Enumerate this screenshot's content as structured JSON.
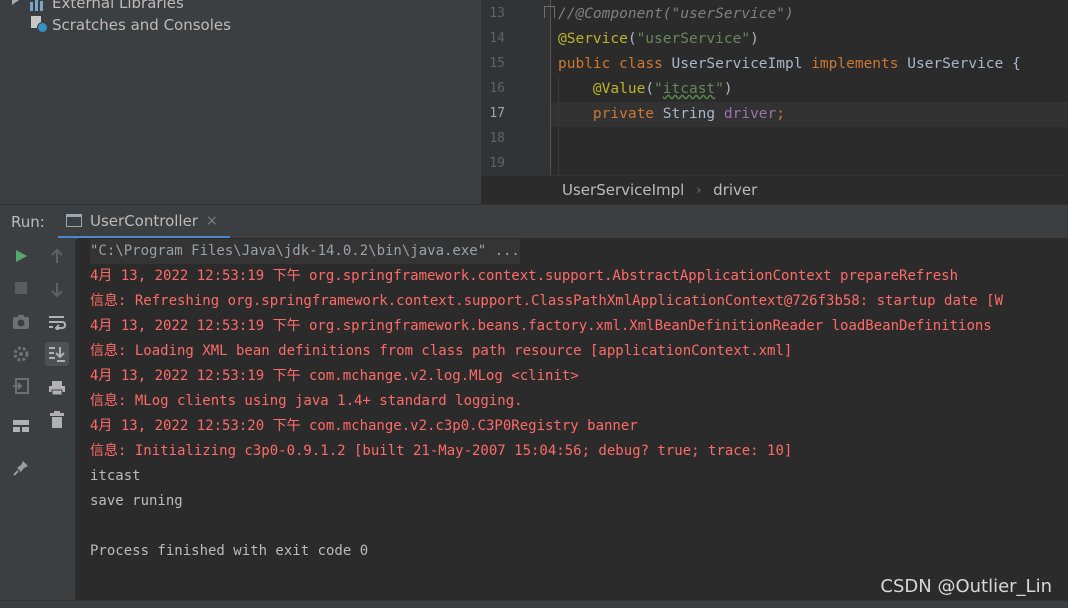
{
  "project_tree": {
    "items": [
      {
        "label": "External Libraries",
        "icon": "library-icon"
      },
      {
        "label": "Scratches and Consoles",
        "icon": "scratches-icon"
      }
    ]
  },
  "editor": {
    "lines": [
      {
        "num": "13",
        "text": "//@Component(\"userService\")"
      },
      {
        "num": "14",
        "text": "@Service(\"userService\")"
      },
      {
        "num": "15",
        "text": "public class UserServiceImpl implements UserService {"
      },
      {
        "num": "16",
        "text": "    @Value(\"itcast\")"
      },
      {
        "num": "17",
        "text": "    private String driver;"
      },
      {
        "num": "18",
        "text": ""
      },
      {
        "num": "19",
        "text": ""
      }
    ],
    "current_line": "17",
    "colors": {
      "keyword": "#cc7832",
      "annotation": "#bbb529",
      "string": "#6a8759",
      "comment": "#808080",
      "field": "#9876aa"
    }
  },
  "breadcrumb": {
    "items": [
      "UserServiceImpl",
      "driver"
    ]
  },
  "run_window": {
    "label": "Run:",
    "tab_label": "UserController",
    "tab_close": "×"
  },
  "console": {
    "lines": [
      {
        "text": "\"C:\\Program Files\\Java\\jdk-14.0.2\\bin\\java.exe\" ...",
        "style": "cmd"
      },
      {
        "text": "4月 13, 2022 12:53:19 下午 org.springframework.context.support.AbstractApplicationContext prepareRefresh",
        "style": "red"
      },
      {
        "text": "信息: Refreshing org.springframework.context.support.ClassPathXmlApplicationContext@726f3b58: startup date [W",
        "style": "red"
      },
      {
        "text": "4月 13, 2022 12:53:19 下午 org.springframework.beans.factory.xml.XmlBeanDefinitionReader loadBeanDefinitions",
        "style": "red"
      },
      {
        "text": "信息: Loading XML bean definitions from class path resource [applicationContext.xml]",
        "style": "red"
      },
      {
        "text": "4月 13, 2022 12:53:19 下午 com.mchange.v2.log.MLog <clinit>",
        "style": "red"
      },
      {
        "text": "信息: MLog clients using java 1.4+ standard logging.",
        "style": "red"
      },
      {
        "text": "4月 13, 2022 12:53:20 下午 com.mchange.v2.c3p0.C3P0Registry banner",
        "style": "red"
      },
      {
        "text": "信息: Initializing c3p0-0.9.1.2 [built 21-May-2007 15:04:56; debug? true; trace: 10]",
        "style": "red"
      },
      {
        "text": "itcast",
        "style": "normal"
      },
      {
        "text": "save runing",
        "style": "normal"
      },
      {
        "text": "",
        "style": "normal"
      },
      {
        "text": "Process finished with exit code 0",
        "style": "normal"
      }
    ],
    "colors": {
      "error_text": "#ff6b68",
      "normal_text": "#bbbbbb",
      "command_text": "#9da0a3"
    }
  },
  "toolbar_left": [
    "rerun-icon",
    "stop-icon",
    "screenshot-icon",
    "settings-icon",
    "exit-icon",
    "layout-icon",
    "pin-icon"
  ],
  "toolbar_right": [
    "up-icon",
    "down-icon",
    "soft-wrap-icon",
    "scroll-to-end-icon",
    "print-icon",
    "delete-icon"
  ],
  "watermark": "CSDN @Outlier_Lin"
}
